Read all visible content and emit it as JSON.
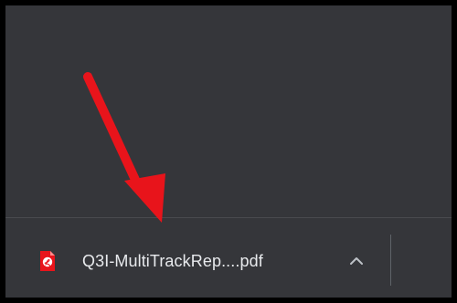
{
  "download_shelf": {
    "item": {
      "icon": "pdf-file-icon",
      "file_name": "Q3I-MultiTrackRep....pdf"
    },
    "menu_icon": "chevron-up-icon"
  },
  "annotation": {
    "arrow_color": "#e8141b"
  },
  "colors": {
    "background": "#35363a",
    "frame": "#000000",
    "text": "#e8eaed",
    "pdf_icon": "#e8141b"
  }
}
